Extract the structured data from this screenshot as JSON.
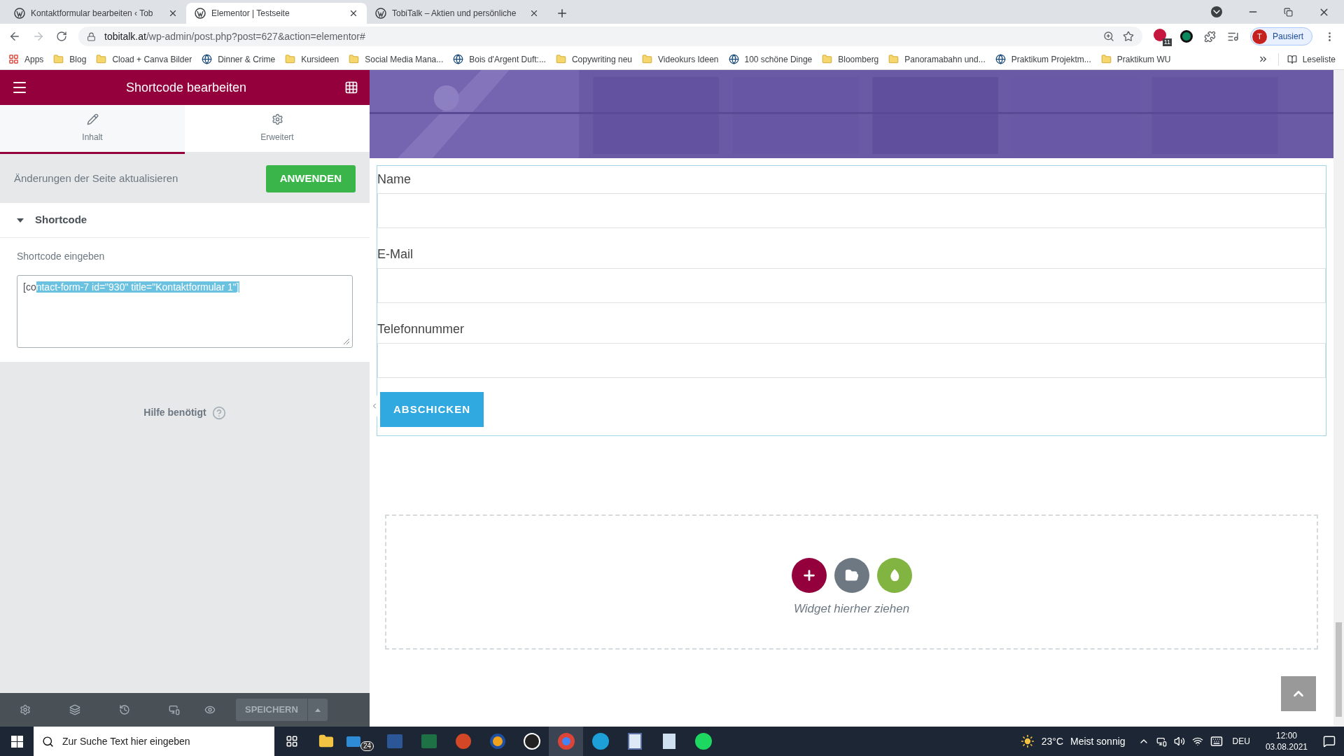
{
  "browser_tabs": [
    {
      "title": "Kontaktformular bearbeiten ‹ Tob",
      "selected": false
    },
    {
      "title": "Elementor | Testseite",
      "selected": true
    },
    {
      "title": "TobiTalk – Aktien und persönliche",
      "selected": false
    }
  ],
  "address": {
    "host": "tobitalk.at",
    "path": "/wp-admin/post.php?post=627&action=elementor#"
  },
  "extension_badge": "11",
  "profile": {
    "initial": "T",
    "label": "Pausiert"
  },
  "bookmarks": [
    {
      "label": "Apps",
      "kind": "apps"
    },
    {
      "label": "Blog",
      "kind": "folder"
    },
    {
      "label": "Cload + Canva Bilder",
      "kind": "folder"
    },
    {
      "label": "Dinner & Crime",
      "kind": "site"
    },
    {
      "label": "Kursideen",
      "kind": "folder"
    },
    {
      "label": "Social Media Mana...",
      "kind": "folder"
    },
    {
      "label": "Bois d'Argent Duft:...",
      "kind": "site"
    },
    {
      "label": "Copywriting neu",
      "kind": "folder"
    },
    {
      "label": "Videokurs Ideen",
      "kind": "folder"
    },
    {
      "label": "100 schöne Dinge",
      "kind": "site"
    },
    {
      "label": "Bloomberg",
      "kind": "folder"
    },
    {
      "label": "Panoramabahn und...",
      "kind": "folder"
    },
    {
      "label": "Praktikum Projektm...",
      "kind": "site"
    },
    {
      "label": "Praktikum WU",
      "kind": "folder"
    }
  ],
  "reading_list": "Leseliste",
  "panel": {
    "title": "Shortcode bearbeiten",
    "tabs": [
      {
        "label": "Inhalt",
        "kind": "pencil",
        "selected": true
      },
      {
        "label": "Erweitert",
        "kind": "gear",
        "selected": false
      }
    ],
    "apply_text": "Änderungen der Seite aktualisieren",
    "apply_button": "ANWENDEN",
    "section": {
      "title": "Shortcode",
      "expanded": true
    },
    "field": {
      "label": "Shortcode eingeben",
      "value_before_selection": "[co",
      "value_selected": "ntact-form-7 id=\"930\" title=\"Kontaktformular 1\"]"
    },
    "help": "Hilfe benötigt",
    "save_button": "SPEICHERN"
  },
  "form": {
    "fields": [
      {
        "label": "Name"
      },
      {
        "label": "E-Mail"
      },
      {
        "label": "Telefonnummer"
      }
    ],
    "submit": "ABSCHICKEN"
  },
  "drop_zone": {
    "text": "Widget hierher ziehen"
  },
  "taskbar": {
    "search_placeholder": "Zur Suche Text hier eingeben",
    "mail_badge": "24",
    "temperature": "23°C",
    "weather": "Meist sonnig",
    "language": "DEU",
    "time": "12:00",
    "date": "03.08.2021"
  }
}
